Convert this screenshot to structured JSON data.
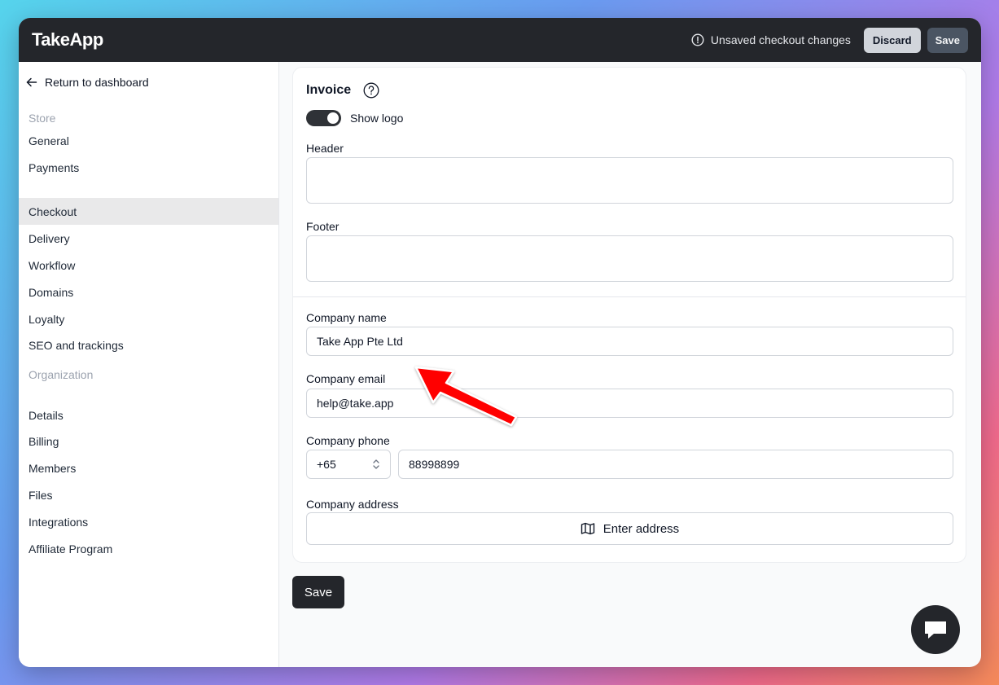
{
  "app": {
    "logo": "TakeApp"
  },
  "topbar": {
    "unsaved_text": "Unsaved checkout changes",
    "discard_label": "Discard",
    "save_label": "Save"
  },
  "sidebar": {
    "back_label": "Return to dashboard",
    "store_title": "Store",
    "store_items": [
      "General",
      "Payments",
      "Checkout",
      "Delivery",
      "Workflow",
      "Domains",
      "Loyalty",
      "SEO and trackings"
    ],
    "active_item": "Checkout",
    "org_title": "Organization",
    "org_items": [
      "Details",
      "Billing",
      "Members",
      "Files",
      "Integrations",
      "Affiliate Program"
    ]
  },
  "invoice": {
    "title": "Invoice",
    "show_logo_label": "Show logo",
    "show_logo_on": true,
    "header_label": "Header",
    "header_value": "",
    "footer_label": "Footer",
    "footer_value": "",
    "company_name_label": "Company name",
    "company_name_value": "Take App Pte Ltd",
    "company_email_label": "Company email",
    "company_email_value": "help@take.app",
    "company_phone_label": "Company phone",
    "country_code": "+65",
    "phone_value": "88998899",
    "company_address_label": "Company address",
    "enter_address_label": "Enter address"
  },
  "footer": {
    "save_label": "Save"
  },
  "icons": {
    "back": "arrow-left-icon",
    "unsaved": "alert-circle-icon",
    "help": "question-circle-icon",
    "select": "chevron-up-down-icon",
    "map": "map-icon",
    "chat": "chat-bubble-icon"
  },
  "colors": {
    "topbar": "#24262b",
    "annotation_arrow": "#ff0000"
  }
}
